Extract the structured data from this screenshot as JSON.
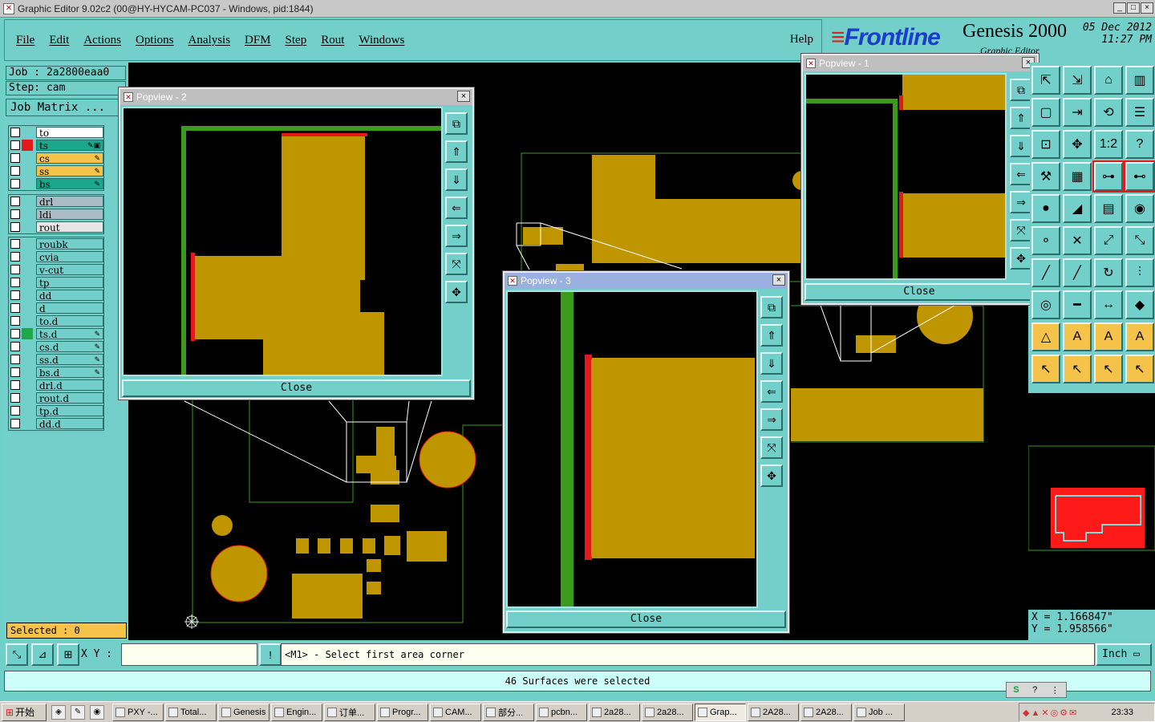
{
  "window": {
    "title": "Graphic Editor 9.02c2 (00@HY-HYCAM-PC037 - Windows, pid:1844)",
    "controls": [
      "_",
      "□",
      "×"
    ]
  },
  "menu": {
    "items": [
      "File",
      "Edit",
      "Actions",
      "Options",
      "Analysis",
      "DFM",
      "Step",
      "Rout",
      "Windows"
    ],
    "help": "Help"
  },
  "logo": {
    "brand": "Frontline",
    "product": "Genesis 2000",
    "subtitle": "Graphic Editor",
    "date": "05 Dec 2012",
    "time": "11:27 PM"
  },
  "job": {
    "job_line": "Job : 2a2800eaa0",
    "step_line": "Step: cam",
    "matrix_label": "Job Matrix ..."
  },
  "layers": {
    "group1": [
      {
        "name": "to",
        "bg": "#ffffff",
        "color": "",
        "mark": ""
      },
      {
        "name": "ts",
        "bg": "#1aa88c",
        "color": "#e21a1a",
        "mark": "✎▣"
      },
      {
        "name": "cs",
        "bg": "#f5c24a",
        "color": "",
        "mark": "✎"
      },
      {
        "name": "ss",
        "bg": "#f5c24a",
        "color": "",
        "mark": "✎"
      },
      {
        "name": "bs",
        "bg": "#1aa88c",
        "color": "",
        "mark": "✎"
      }
    ],
    "group2": [
      {
        "name": "drl",
        "bg": "#a9bcc6",
        "color": "",
        "mark": ""
      },
      {
        "name": "ldi",
        "bg": "#a9bcc6",
        "color": "",
        "mark": ""
      },
      {
        "name": "rout",
        "bg": "#e6e6e6",
        "color": "",
        "mark": ""
      }
    ],
    "group3": [
      {
        "name": "roubk",
        "bg": "#73cfc9",
        "color": "",
        "mark": ""
      },
      {
        "name": "cvia",
        "bg": "#73cfc9",
        "color": "",
        "mark": ""
      },
      {
        "name": "v-cut",
        "bg": "#73cfc9",
        "color": "",
        "mark": ""
      },
      {
        "name": "tp",
        "bg": "#73cfc9",
        "color": "",
        "mark": ""
      },
      {
        "name": "dd",
        "bg": "#73cfc9",
        "color": "",
        "mark": ""
      },
      {
        "name": "d",
        "bg": "#73cfc9",
        "color": "",
        "mark": ""
      },
      {
        "name": "to.d",
        "bg": "#73cfc9",
        "color": "",
        "mark": ""
      },
      {
        "name": "ts.d",
        "bg": "#73cfc9",
        "color": "#1fa84a",
        "mark": "✎"
      },
      {
        "name": "cs.d",
        "bg": "#73cfc9",
        "color": "",
        "mark": "✎"
      },
      {
        "name": "ss.d",
        "bg": "#73cfc9",
        "color": "",
        "mark": "✎"
      },
      {
        "name": "bs.d",
        "bg": "#73cfc9",
        "color": "",
        "mark": "✎"
      },
      {
        "name": "drl.d",
        "bg": "#73cfc9",
        "color": "",
        "mark": ""
      },
      {
        "name": "rout.d",
        "bg": "#73cfc9",
        "color": "",
        "mark": ""
      },
      {
        "name": "tp.d",
        "bg": "#73cfc9",
        "color": "",
        "mark": ""
      },
      {
        "name": "dd.d",
        "bg": "#73cfc9",
        "color": "",
        "mark": ""
      }
    ],
    "selected": "Selected : 0"
  },
  "popviews": [
    {
      "title": "Popview - 2",
      "close": "Close"
    },
    {
      "title": "Popview - 3",
      "close": "Close"
    },
    {
      "title": "Popview - 1",
      "close": "Close"
    }
  ],
  "popview_tools": [
    "⧉",
    "⇑",
    "⇓",
    "⇐",
    "⇒",
    "⤧",
    "✥"
  ],
  "palette_icons": [
    "import-icon",
    "export-icon",
    "home-icon",
    "panel-icon",
    "frame-icon",
    "arrow-out-icon",
    "snap-icon",
    "align-icon",
    "zoom-box-icon",
    "pan-icon",
    "ratio-icon",
    "help-icon",
    "tools-icon",
    "grid-icon",
    "net-icon",
    "net-alt-icon",
    "pad-icon",
    "marker-icon",
    "ruler-icon",
    "dot-icon",
    "route-icon",
    "cross-icon",
    "link-icon",
    "link2-icon",
    "pencil-icon",
    "slash-icon",
    "arc-icon",
    "feature-icon",
    "via-icon",
    "line-icon",
    "measure-icon",
    "shapes-icon",
    "triangle-icon",
    "text-icon",
    "text-fill-icon",
    "text-line-icon",
    "select-icon",
    "select-box-icon",
    "select-net-icon",
    "select-route-icon"
  ],
  "palette_labels": {
    "ratio": "1:2",
    "help": "?"
  },
  "colors": {
    "surface": "#bf9500",
    "trace": "#3c9a1c",
    "highlight": "#e21a1a",
    "outline": "#3c9a1c",
    "panel": "#73cfc9"
  },
  "coords": {
    "x": "X = 1.166847\"",
    "y": "Y = 1.958566\""
  },
  "command": {
    "xy_label": "X Y :",
    "xy_value": "",
    "prompt": "<M1> - Select first area corner",
    "units": "Inch",
    "status": "46 Surfaces were selected"
  },
  "taskbar": {
    "start": "开始",
    "tasks": [
      "PXY -...",
      "Total...",
      "Genesis",
      "Engin...",
      "订单...",
      "Progr...",
      "CAM...",
      "部分...",
      "pcbn...",
      "2a28...",
      "2a28...",
      "Grap...",
      "2A28...",
      "2A28...",
      "Job ..."
    ],
    "active_task": "Grap...",
    "clock": "23:33"
  }
}
